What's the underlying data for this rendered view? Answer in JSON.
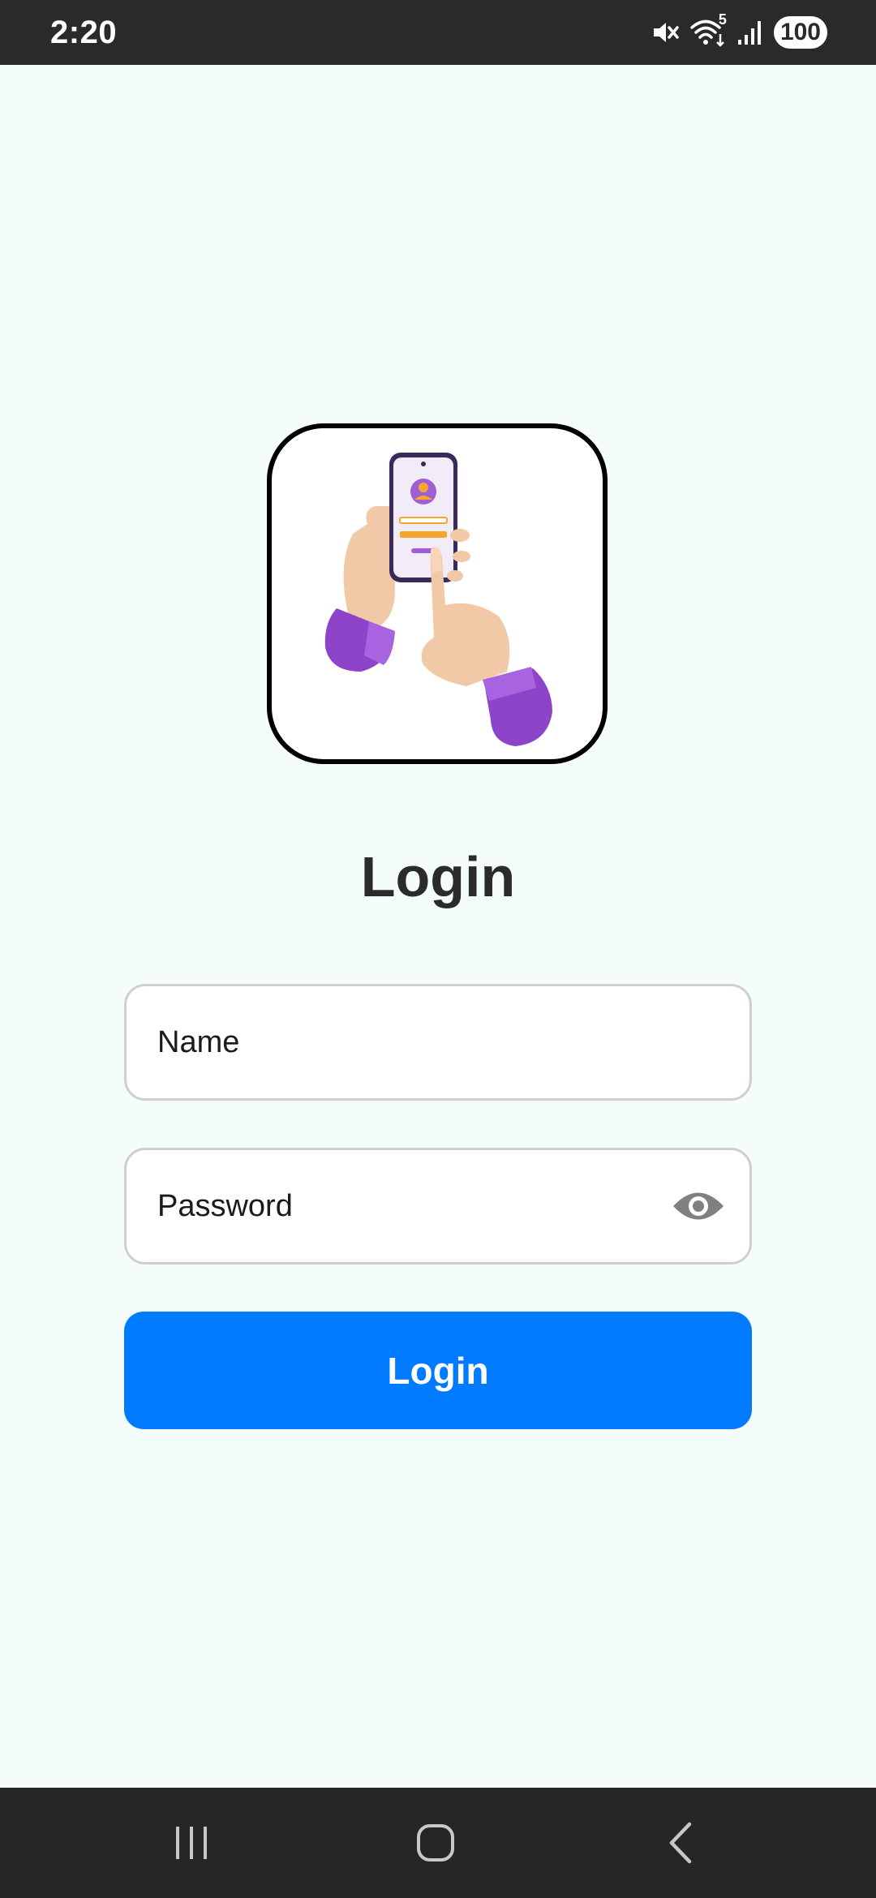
{
  "status_bar": {
    "time": "2:20",
    "icons": [
      "mute-icon",
      "wifi-icon",
      "signal-icon"
    ],
    "wifi_label": "5",
    "battery": "100"
  },
  "illustration": {
    "icon": "hands-holding-phone-login-illustration"
  },
  "page": {
    "title": "Login"
  },
  "form": {
    "name_placeholder": "Name",
    "password_placeholder": "Password",
    "password_toggle_icon": "eye-icon",
    "submit_label": "Login"
  },
  "nav_bar": {
    "icons": [
      "recent-apps-icon",
      "home-icon",
      "back-icon"
    ]
  },
  "colors": {
    "background": "#f4fdfb",
    "primary_button": "#007bff",
    "title_text": "#2b2b2b",
    "status_bar": "#2a2a2a",
    "nav_bar": "#262626"
  }
}
